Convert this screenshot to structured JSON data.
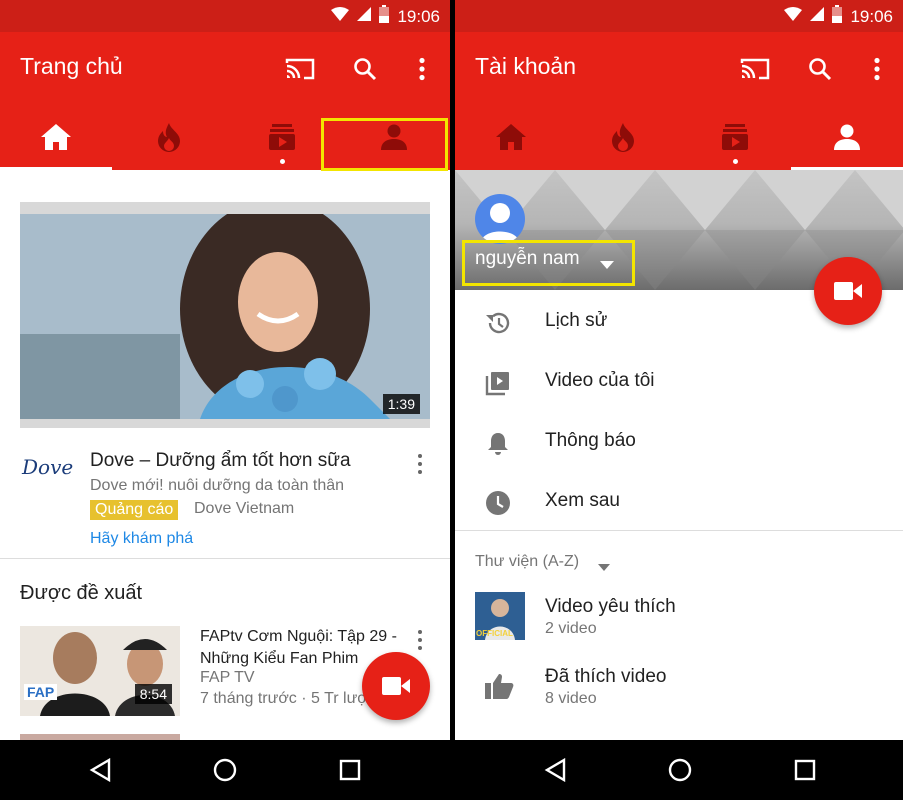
{
  "status_bar": {
    "time": "19:06"
  },
  "colors": {
    "youtube_red": "#e62117",
    "status_red": "#cc1f17",
    "highlight": "#f3e500",
    "link_blue": "#1e88e5",
    "ad_badge": "#e7c12e"
  },
  "left_screen": {
    "title": "Trang chủ",
    "actions": [
      "cast-icon",
      "search-icon",
      "more-vert-icon"
    ],
    "tabs": [
      "home-icon",
      "trending-icon",
      "subscriptions-icon",
      "account-icon"
    ],
    "ad": {
      "duration": "1:39",
      "logo_text": "Dove",
      "title": "Dove – Dưỡng ẩm tốt hơn sữa",
      "subtitle": "Dove mới! nuôi dưỡng da toàn thân",
      "badge": "Quảng cáo",
      "channel": "Dove Vietnam",
      "link": "Hãy khám phá"
    },
    "section_title": "Được đề xuất",
    "videos": [
      {
        "title": "FAPtv Cơm Nguội: Tập 29 - Những Kiểu Fan Phim",
        "channel": "FAP TV",
        "meta": "7 tháng trước · 5 Tr lượt xem",
        "duration": "8:54",
        "thumb_logo": "FAP"
      }
    ]
  },
  "right_screen": {
    "title": "Tài khoản",
    "actions": [
      "cast-icon",
      "search-icon",
      "more-vert-icon"
    ],
    "tabs": [
      "home-icon",
      "trending-icon",
      "subscriptions-icon",
      "account-icon"
    ],
    "user": {
      "name": "nguyễn nam"
    },
    "menu": [
      {
        "label": "Lịch sử",
        "icon": "history-icon"
      },
      {
        "label": "Video của tôi",
        "icon": "my-videos-icon"
      },
      {
        "label": "Thông báo",
        "icon": "bell-icon"
      },
      {
        "label": "Xem sau",
        "icon": "clock-icon"
      }
    ],
    "library_header": "Thư viện (A-Z)",
    "library": [
      {
        "title": "Video yêu thích",
        "sub": "2 video",
        "thumb_text": "OFFICIAL"
      },
      {
        "title": "Đã thích video",
        "sub": "8 video",
        "icon": "thumb-up-icon"
      }
    ]
  }
}
